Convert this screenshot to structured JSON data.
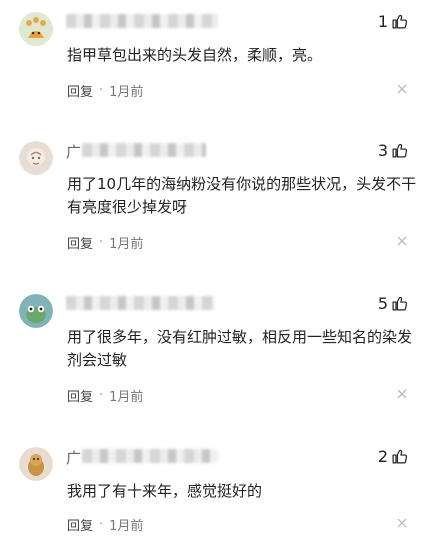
{
  "comments": [
    {
      "name_prefix": "",
      "likes": "1",
      "text": "指甲草包出来的头发自然，柔顺，亮。",
      "reply_label": "回复",
      "separator": "·",
      "time": "1月前"
    },
    {
      "name_prefix": "广",
      "likes": "3",
      "text": "用了10几年的海纳粉没有你说的那些状况，头发不干有亮度很少掉发呀",
      "reply_label": "回复",
      "separator": "·",
      "time": "1月前"
    },
    {
      "name_prefix": "",
      "likes": "5",
      "text": "用了很多年，没有红肿过敏，相反用一些知名的染发剂会过敏",
      "reply_label": "回复",
      "separator": "·",
      "time": "1月前"
    },
    {
      "name_prefix": "广",
      "likes": "2",
      "text": "我用了有十来年，感觉挺好的",
      "reply_label": "回复",
      "separator": "·",
      "time": "1月前"
    }
  ],
  "colors": {
    "text": "#222222",
    "meta": "#777777",
    "background": "#ffffff"
  },
  "icons": [
    "thumbs-up-icon",
    "close-icon"
  ]
}
